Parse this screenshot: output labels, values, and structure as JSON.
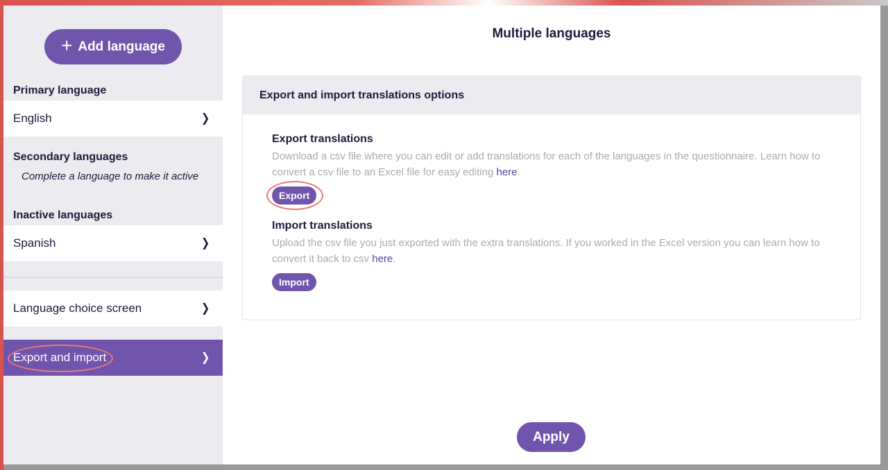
{
  "sidebar": {
    "add_language_label": "Add language",
    "primary_heading": "Primary language",
    "primary_items": [
      {
        "label": "English"
      }
    ],
    "secondary_heading": "Secondary languages",
    "secondary_hint": "Complete a language to make it active",
    "inactive_heading": "Inactive languages",
    "inactive_items": [
      {
        "label": "Spanish"
      }
    ],
    "extra_items": [
      {
        "label": "Language choice screen",
        "active": false
      },
      {
        "label": "Export and import",
        "active": true
      }
    ]
  },
  "main": {
    "title": "Multiple languages",
    "card": {
      "header": "Export and import translations options",
      "export": {
        "title": "Export translations",
        "description": "Download a csv file where you can edit or add translations for each of the languages in the questionnaire. Learn how to convert a csv file to an Excel file for easy editing ",
        "link_label": "here",
        "suffix": ".",
        "button_label": "Export"
      },
      "import": {
        "title": "Import translations",
        "description": "Upload the csv file you just exported with the extra translations. If you worked in the Excel version you can learn how to convert it back to csv ",
        "link_label": "here",
        "suffix": ".",
        "button_label": "Import"
      }
    },
    "apply_label": "Apply"
  },
  "colors": {
    "accent": "#7155ad",
    "highlight_ring": "#ea7a76",
    "sidebar_bg": "#ebebf0",
    "text": "#1c1a3a",
    "muted_text": "#aaaab2"
  },
  "icons": {
    "add": "plus-icon",
    "row_arrow": "chevron-right-icon"
  }
}
